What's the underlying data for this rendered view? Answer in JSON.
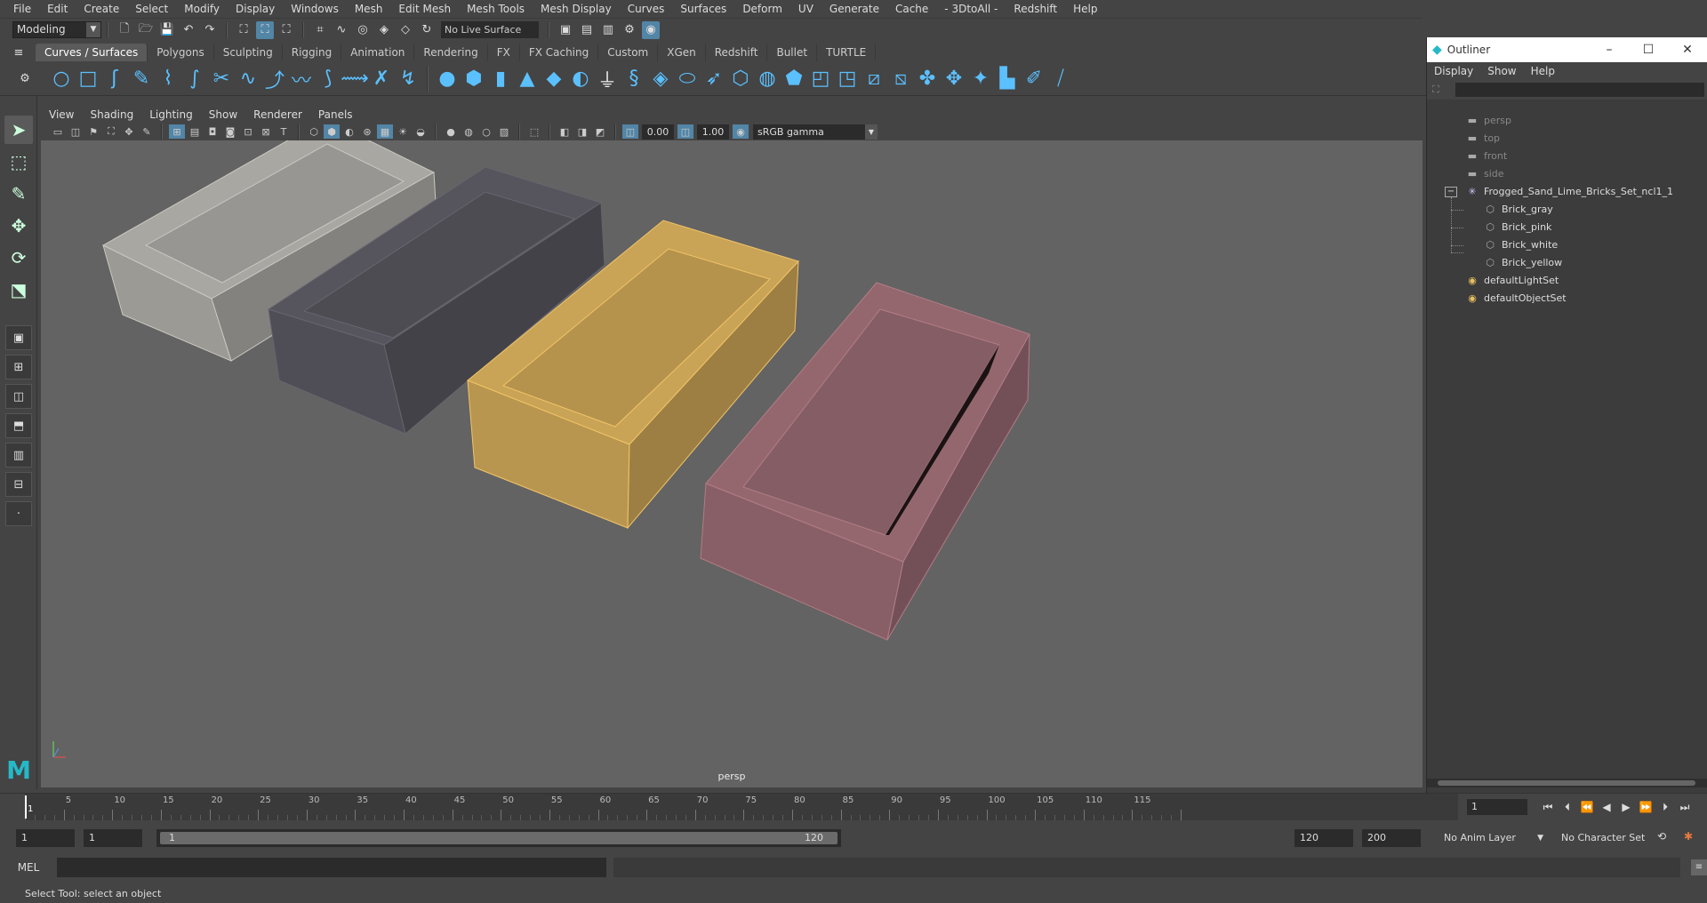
{
  "menubar": {
    "items": [
      "File",
      "Edit",
      "Create",
      "Select",
      "Modify",
      "Display",
      "Windows",
      "Mesh",
      "Edit Mesh",
      "Mesh Tools",
      "Mesh Display",
      "Curves",
      "Surfaces",
      "Deform",
      "UV",
      "Generate",
      "Cache",
      "- 3DtoAll -",
      "Redshift",
      "Help"
    ]
  },
  "statusline": {
    "mode": "Modeling",
    "live_surface": "No Live Surface"
  },
  "shelf": {
    "tabs": [
      "Curves / Surfaces",
      "Polygons",
      "Sculpting",
      "Rigging",
      "Animation",
      "Rendering",
      "FX",
      "FX Caching",
      "Custom",
      "XGen",
      "Redshift",
      "Bullet",
      "TURTLE"
    ],
    "active_tab": "Curves / Surfaces"
  },
  "panel": {
    "menus": [
      "View",
      "Shading",
      "Lighting",
      "Show",
      "Renderer",
      "Panels"
    ],
    "exposure": "0.00",
    "gamma_value": "1.00",
    "color_space": "sRGB gamma",
    "camera_label": "persp"
  },
  "viewport": {
    "objects": [
      {
        "name": "Brick_white",
        "color": "#a9a7a2"
      },
      {
        "name": "Brick_gray",
        "color": "#56545c"
      },
      {
        "name": "Brick_yellow",
        "color": "#c9a356"
      },
      {
        "name": "Brick_pink",
        "color": "#94676f"
      }
    ],
    "background": "#636363"
  },
  "outliner": {
    "title": "Outliner",
    "menus": [
      "Display",
      "Show",
      "Help"
    ],
    "items": [
      {
        "label": "persp",
        "dim": true
      },
      {
        "label": "top",
        "dim": true
      },
      {
        "label": "front",
        "dim": true
      },
      {
        "label": "side",
        "dim": true
      },
      {
        "label": "Frogged_Sand_Lime_Bricks_Set_ncl1_1",
        "dim": false
      },
      {
        "label": "Brick_gray",
        "dim": false
      },
      {
        "label": "Brick_pink",
        "dim": false
      },
      {
        "label": "Brick_white",
        "dim": false
      },
      {
        "label": "Brick_yellow",
        "dim": false
      },
      {
        "label": "defaultLightSet",
        "dim": false
      },
      {
        "label": "defaultObjectSet",
        "dim": false
      }
    ],
    "collapse_symbol": "−"
  },
  "timeline": {
    "ticks": [
      "5",
      "10",
      "15",
      "20",
      "25",
      "30",
      "35",
      "40",
      "45",
      "50",
      "55",
      "60",
      "65",
      "70",
      "75",
      "80",
      "85",
      "90",
      "95",
      "100",
      "105",
      "110",
      "115"
    ],
    "current_frame_mark": "1",
    "current_frame": "1"
  },
  "range": {
    "start_anim": "1",
    "start_play": "1",
    "slider_start": "1",
    "slider_end": "120",
    "end_play": "120",
    "end_anim": "200",
    "anim_layer": "No Anim Layer",
    "char_set": "No Character Set"
  },
  "cmdline": {
    "label": "MEL"
  },
  "helpline": {
    "text": "Select Tool: select an object"
  }
}
